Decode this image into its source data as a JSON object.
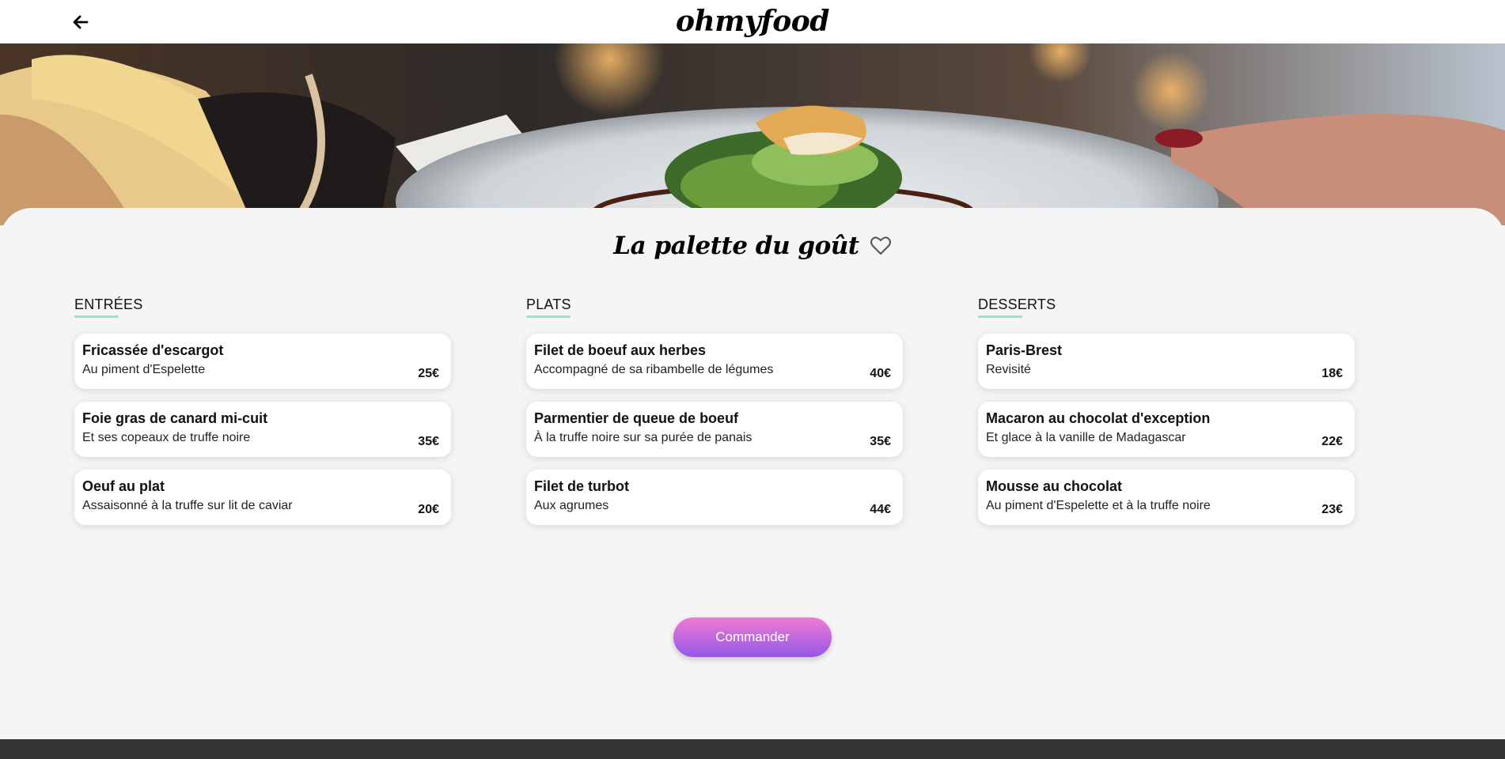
{
  "header": {
    "back_icon": "arrow-left-icon",
    "logo": "ohmyfood"
  },
  "restaurant": {
    "name": "La palette du goût",
    "favorite_icon": "heart-outline-icon"
  },
  "menu": {
    "entrees": {
      "title": "ENTRÉES",
      "items": [
        {
          "name": "Fricassée d'escargot",
          "desc": "Au piment d'Espelette",
          "price": "25€"
        },
        {
          "name": "Foie gras de canard mi-cuit",
          "desc": "Et ses copeaux de truffe noire",
          "price": "35€"
        },
        {
          "name": "Oeuf au plat",
          "desc": "Assaisonné à la truffe sur lit de caviar",
          "price": "20€"
        }
      ]
    },
    "plats": {
      "title": "PLATS",
      "items": [
        {
          "name": "Filet de boeuf aux herbes",
          "desc": "Accompagné de sa ribambelle de légumes",
          "price": "40€"
        },
        {
          "name": "Parmentier de queue de boeuf",
          "desc": "À la truffe noire sur sa purée de panais",
          "price": "35€"
        },
        {
          "name": "Filet de turbot",
          "desc": "Aux agrumes",
          "price": "44€"
        }
      ]
    },
    "desserts": {
      "title": "DESSERTS",
      "items": [
        {
          "name": "Paris-Brest",
          "desc": "Revisité",
          "price": "18€"
        },
        {
          "name": "Macaron au chocolat d'exception",
          "desc": "Et glace à la vanille de Madagascar",
          "price": "22€"
        },
        {
          "name": "Mousse au chocolat",
          "desc": "Au piment d'Espelette et à la truffe noire",
          "price": "23€"
        }
      ]
    }
  },
  "actions": {
    "order_label": "Commander"
  },
  "colors": {
    "accent_underline": "#99e2d0",
    "button_gradient_top": "#f07ad6",
    "button_gradient_bottom": "#9458e6",
    "footer": "#353535",
    "background": "#f5f5f5"
  }
}
